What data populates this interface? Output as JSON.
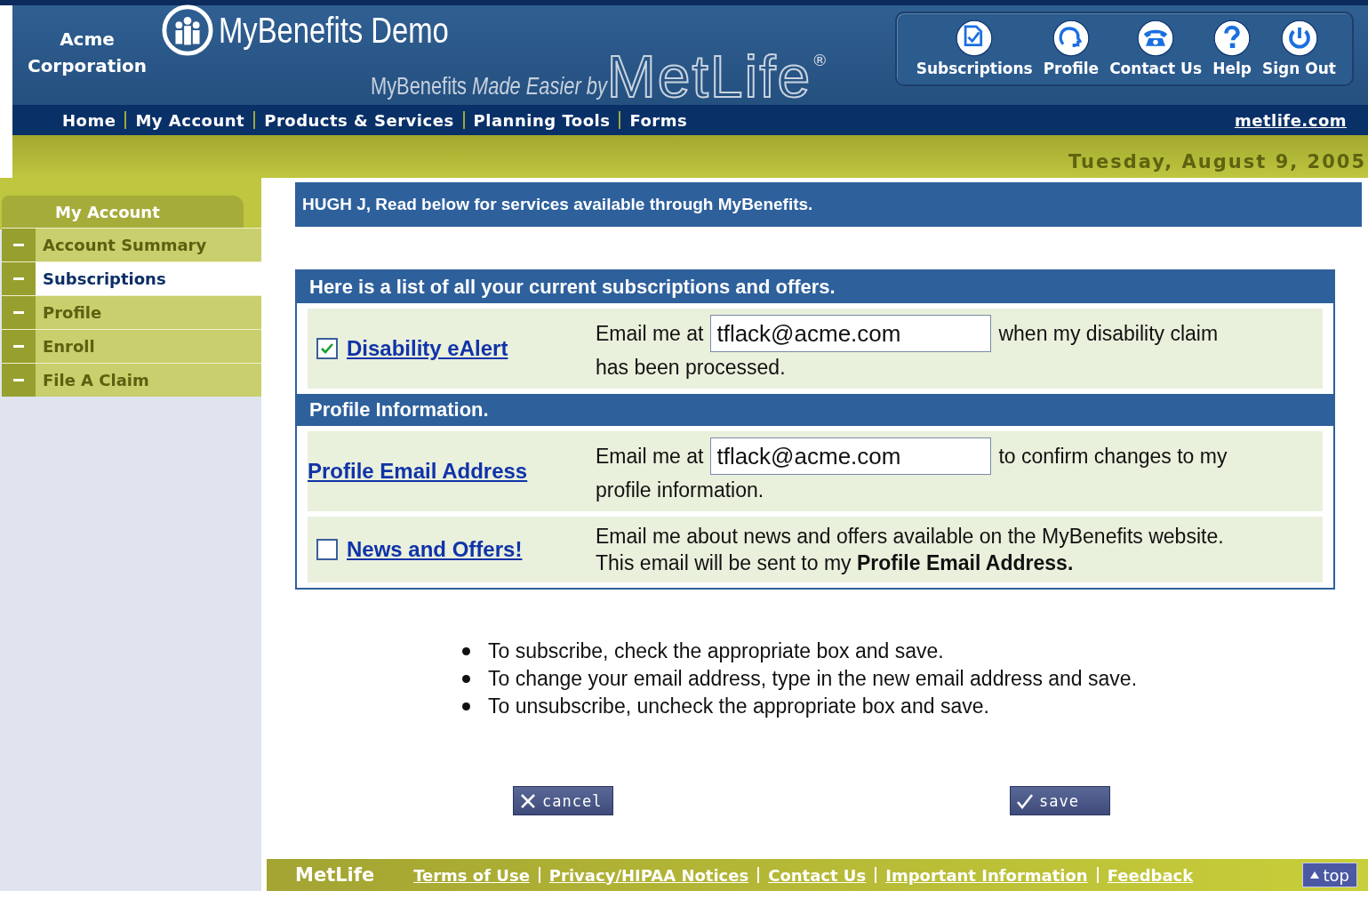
{
  "header": {
    "company": "Acme Corporation",
    "app_title": "MyBenefits Demo",
    "tagline": "MyBenefits *Made Easier by*",
    "brand": "MetLife",
    "brand_mark": "®",
    "toolbar": [
      {
        "label": "Subscriptions",
        "kind": "document"
      },
      {
        "label": "Profile",
        "kind": "head"
      },
      {
        "label": "Contact Us",
        "kind": "phone"
      },
      {
        "label": "Help",
        "kind": "help"
      },
      {
        "label": "Sign Out",
        "kind": "power"
      }
    ]
  },
  "nav": {
    "items": [
      "Home",
      "My Account",
      "Products & Services",
      "Planning Tools",
      "Forms"
    ],
    "external_link": "metlife.com"
  },
  "date": "Tuesday, August 9, 2005",
  "sidebar": {
    "title": "My Account",
    "items": [
      {
        "label": "Account Summary",
        "selected": false
      },
      {
        "label": "Subscriptions",
        "selected": true
      },
      {
        "label": "Profile",
        "selected": false
      },
      {
        "label": "Enroll",
        "selected": false
      },
      {
        "label": "File A Claim",
        "selected": false
      }
    ]
  },
  "greeting": "HUGH J, Read below for services available through MyBenefits.",
  "sections": [
    {
      "title": "Here is a list of all your current subscriptions and offers.",
      "rows": [
        {
          "kind": "checkbox",
          "checked": true,
          "link": "Disability eAlert",
          "prefix": "Email me at",
          "email": "tflack@acme.com",
          "suffix": "when my disability claim",
          "second_line": "has been processed."
        }
      ]
    },
    {
      "title": "Profile Information.",
      "rows": [
        {
          "kind": "plain",
          "link": "Profile Email Address",
          "prefix": "Email me at",
          "email": "tflack@acme.com",
          "suffix": "to confirm changes to my",
          "second_line": "profile information."
        },
        {
          "kind": "checkbox",
          "checked": false,
          "link": "News and Offers!",
          "text": "Email me about news and offers available on the MyBenefits website. This email will be sent to my **Profile Email Address.**"
        }
      ]
    }
  ],
  "instructions": [
    "To subscribe, check the appropriate box and save.",
    "To change your email address, type in the new email address and save.",
    "To unsubscribe, uncheck the appropriate box and save."
  ],
  "buttons": [
    {
      "kind": "cancel",
      "label": "cancel"
    },
    {
      "kind": "save",
      "label": "save"
    }
  ],
  "footer": {
    "brand": "MetLife",
    "links": [
      "Terms of Use",
      "Privacy/HIPAA Notices",
      "Contact Us",
      "Important Information",
      "Feedback"
    ],
    "top": "top"
  }
}
